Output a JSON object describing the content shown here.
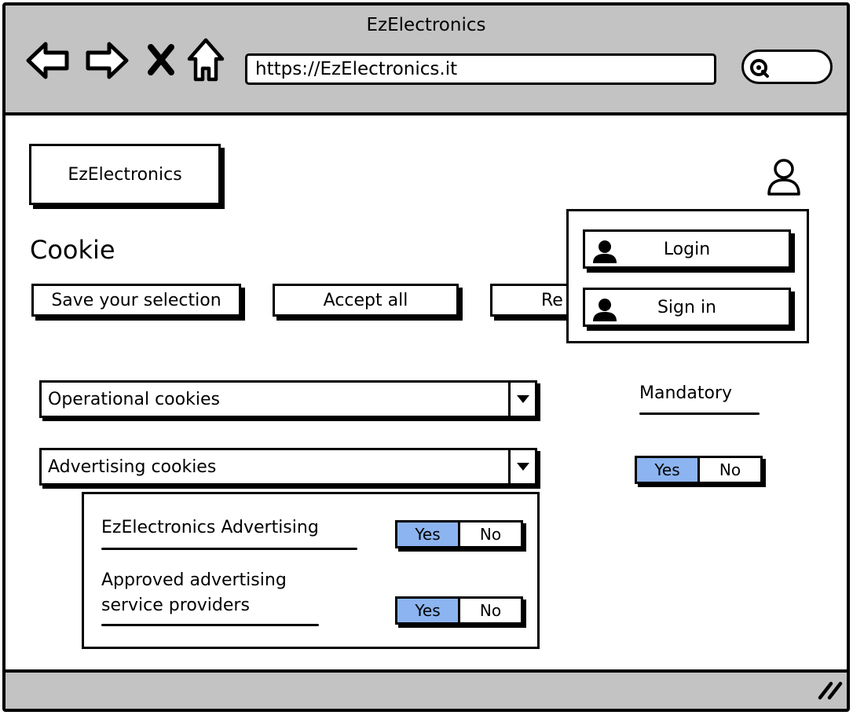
{
  "browser": {
    "title": "EzElectronics",
    "url": "https://EzElectronics.it"
  },
  "header": {
    "logo_text": "EzElectronics"
  },
  "page": {
    "title": "Cookie",
    "buttons": {
      "save": "Save your selection",
      "accept": "Accept all",
      "reject": "Re"
    }
  },
  "user_menu": {
    "items": [
      {
        "label": "Login",
        "icon": "user-icon"
      },
      {
        "label": "Sign in",
        "icon": "user-icon"
      }
    ]
  },
  "cookies": {
    "operational": {
      "label": "Operational cookies"
    },
    "advertising": {
      "label": "Advertising cookies"
    },
    "mandatory": {
      "label": "Mandatory",
      "toggle": {
        "yes": "Yes",
        "no": "No",
        "selected": "Yes"
      }
    },
    "ads_items": [
      {
        "label": "EzElectronics Advertising",
        "toggle": {
          "yes": "Yes",
          "no": "No",
          "selected": "Yes"
        }
      },
      {
        "label_line1": "Approved advertising",
        "label_line2": "service providers",
        "toggle": {
          "yes": "Yes",
          "no": "No",
          "selected": "Yes"
        }
      }
    ]
  },
  "colors": {
    "chrome": "#c3c3c3",
    "toggle_selected": "#8cb4f0"
  }
}
